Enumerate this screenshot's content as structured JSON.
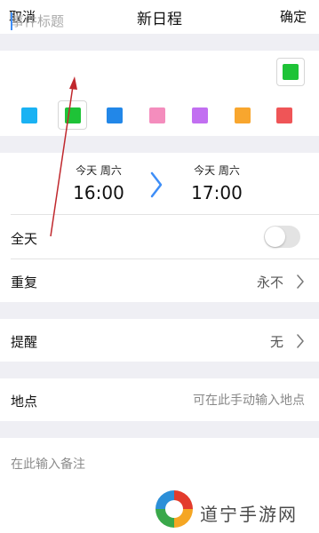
{
  "nav": {
    "cancel": "取消",
    "title": "新日程",
    "confirm": "确定"
  },
  "event": {
    "title_placeholder": "事件标题",
    "selected_color": "#1ec337",
    "colors": [
      {
        "name": "cyan",
        "hex": "#1ab2f3"
      },
      {
        "name": "green",
        "hex": "#1ec337"
      },
      {
        "name": "blue",
        "hex": "#2287e8"
      },
      {
        "name": "pink",
        "hex": "#f48dbd"
      },
      {
        "name": "purple",
        "hex": "#c26ff1"
      },
      {
        "name": "orange",
        "hex": "#f8a62e"
      },
      {
        "name": "red",
        "hex": "#ef5557"
      }
    ]
  },
  "time": {
    "start": {
      "day": "今天 周六",
      "time": "16:00"
    },
    "end": {
      "day": "今天 周六",
      "time": "17:00"
    }
  },
  "all_day": {
    "label": "全天",
    "on": false
  },
  "repeat": {
    "label": "重复",
    "value": "永不"
  },
  "reminder": {
    "label": "提醒",
    "value": "无"
  },
  "location": {
    "label": "地点",
    "placeholder": "可在此手动输入地点"
  },
  "notes": {
    "placeholder": "在此输入备注"
  },
  "watermark": {
    "text": "道宁手游网"
  },
  "accent_color": "#3e8ef7",
  "annotation_color": "#c0282d"
}
